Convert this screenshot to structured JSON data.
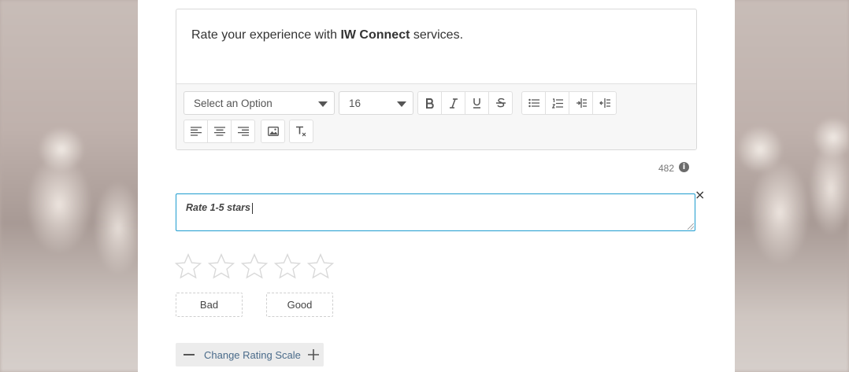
{
  "editor": {
    "text_before": "Rate your experience with ",
    "text_bold": "IW Connect",
    "text_after": " services.",
    "format_select": {
      "value": "Select an Option"
    },
    "size_select": {
      "value": "16"
    }
  },
  "char_count": "482",
  "rate_input": {
    "value": "Rate 1-5 stars"
  },
  "stars": {
    "max": 5,
    "selected": 0
  },
  "scale_labels": {
    "low": "Bad",
    "high": "Good"
  },
  "change_scale": {
    "label": "Change Rating Scale"
  },
  "colors": {
    "accent": "#1e9ccf",
    "link": "#4a6b8a",
    "star_outline": "#d8d8d8"
  }
}
